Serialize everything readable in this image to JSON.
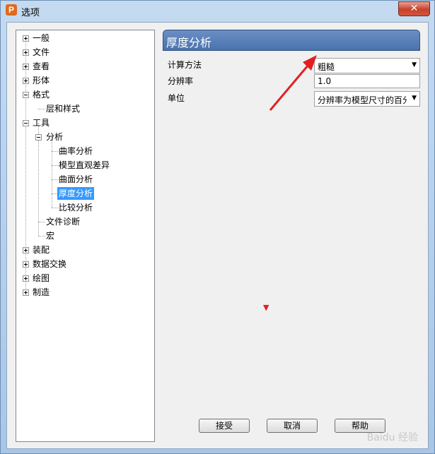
{
  "window": {
    "title": "选项",
    "app_icon_letter": "P",
    "close_glyph": "✕"
  },
  "tree": {
    "items": [
      {
        "label": "一般"
      },
      {
        "label": "文件"
      },
      {
        "label": "查看"
      },
      {
        "label": "形体"
      },
      {
        "label": "格式"
      },
      {
        "label": "层和样式"
      },
      {
        "label": "工具"
      },
      {
        "label": "分析"
      },
      {
        "label": "曲率分析"
      },
      {
        "label": "模型直观差异"
      },
      {
        "label": "曲面分析"
      },
      {
        "label": "厚度分析"
      },
      {
        "label": "比较分析"
      },
      {
        "label": "文件诊断"
      },
      {
        "label": "宏"
      },
      {
        "label": "装配"
      },
      {
        "label": "数据交换"
      },
      {
        "label": "绘图"
      },
      {
        "label": "制造"
      }
    ]
  },
  "panel": {
    "title": "厚度分析",
    "fields": {
      "method_label": "计算方法",
      "method_value": "粗糙",
      "resolution_label": "分辨率",
      "resolution_value": "1.0",
      "unit_label": "单位",
      "unit_value": "分辨率为模型尺寸的百分"
    }
  },
  "buttons": {
    "accept": "接受",
    "cancel": "取消",
    "help": "帮助"
  },
  "watermark": "Baidu 经验",
  "colors": {
    "selection": "#3399ff",
    "header": "#4a72ad",
    "arrow": "#e02020"
  }
}
